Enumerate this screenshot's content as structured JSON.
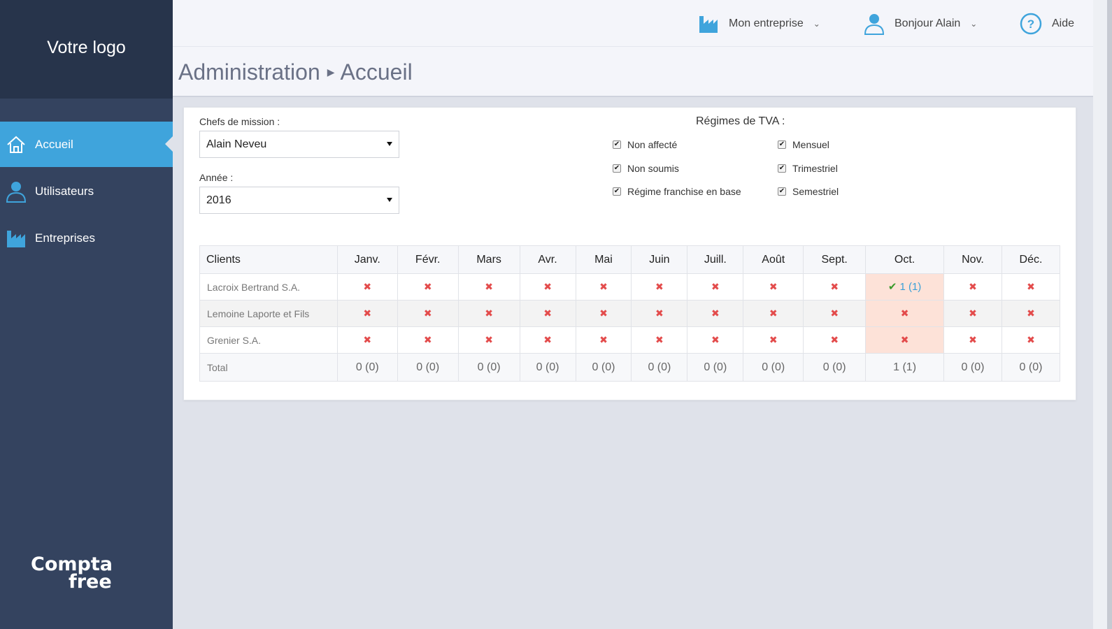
{
  "sidebar": {
    "logo": "Votre logo",
    "items": [
      {
        "label": "Accueil",
        "icon": "home-icon",
        "active": true
      },
      {
        "label": "Utilisateurs",
        "icon": "user-icon",
        "active": false
      },
      {
        "label": "Entreprises",
        "icon": "factory-icon",
        "active": false
      }
    ],
    "brand_line1": "Compta",
    "brand_line2": "free"
  },
  "topbar": {
    "company": "Mon entreprise",
    "user": "Bonjour Alain",
    "help": "Aide"
  },
  "header": {
    "section": "Administration",
    "page": "Accueil"
  },
  "filters": {
    "chefs_label": "Chefs de mission :",
    "chefs_value": "Alain Neveu",
    "year_label": "Année :",
    "year_value": "2016",
    "tva_title": "Régimes de TVA :",
    "tva_options": [
      {
        "label": "Non affecté",
        "checked": true
      },
      {
        "label": "Non soumis",
        "checked": true
      },
      {
        "label": "Régime franchise en base",
        "checked": true
      },
      {
        "label": "Mensuel",
        "checked": true
      },
      {
        "label": "Trimestriel",
        "checked": true
      },
      {
        "label": "Semestriel",
        "checked": true
      }
    ]
  },
  "table": {
    "client_header": "Clients",
    "months": [
      "Janv.",
      "Févr.",
      "Mars",
      "Avr.",
      "Mai",
      "Juin",
      "Juill.",
      "Août",
      "Sept.",
      "Oct.",
      "Nov.",
      "Déc."
    ],
    "rows": [
      {
        "client": "Lacroix Bertrand S.A.",
        "cells": [
          "x",
          "x",
          "x",
          "x",
          "x",
          "x",
          "x",
          "x",
          "x",
          "1 (1)",
          "x",
          "x"
        ]
      },
      {
        "client": "Lemoine Laporte et Fils",
        "cells": [
          "x",
          "x",
          "x",
          "x",
          "x",
          "x",
          "x",
          "x",
          "x",
          "x",
          "x",
          "x"
        ]
      },
      {
        "client": "Grenier S.A.",
        "cells": [
          "x",
          "x",
          "x",
          "x",
          "x",
          "x",
          "x",
          "x",
          "x",
          "x",
          "x",
          "x"
        ]
      }
    ],
    "total_label": "Total",
    "totals": [
      "0 (0)",
      "0 (0)",
      "0 (0)",
      "0 (0)",
      "0 (0)",
      "0 (0)",
      "0 (0)",
      "0 (0)",
      "0 (0)",
      "1 (1)",
      "0 (0)",
      "0 (0)"
    ],
    "highlight_month_index": 9
  },
  "colors": {
    "sidebar": "#34435f",
    "sidebar_logo": "#27344b",
    "active": "#3fa4dc",
    "cross": "#e34b4b",
    "highlight": "#fde2d8"
  }
}
